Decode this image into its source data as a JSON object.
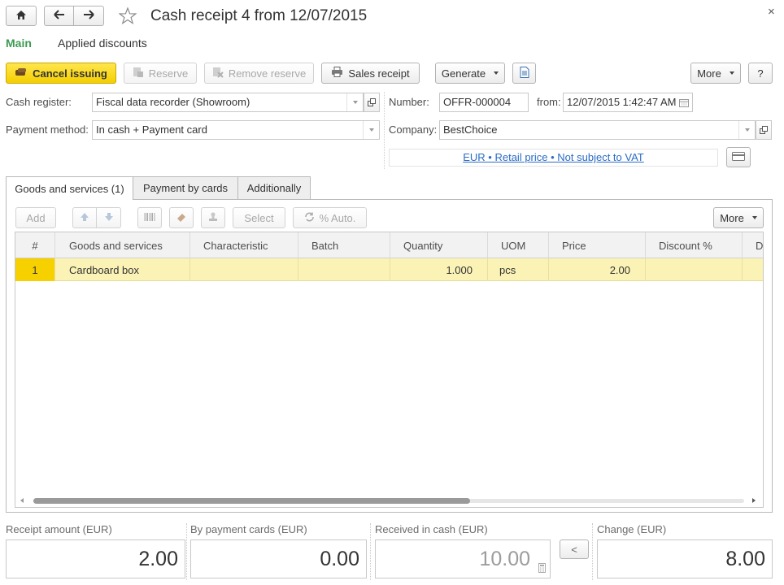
{
  "window": {
    "title": "Cash receipt 4 from 12/07/2015",
    "close_glyph": "×"
  },
  "nav": {
    "home_icon": "home-icon",
    "back_icon": "arrow-left-icon",
    "forward_icon": "arrow-right-icon",
    "star_icon": "star-icon"
  },
  "section_tabs": [
    {
      "label": "Main",
      "active": true
    },
    {
      "label": "Applied discounts",
      "active": false
    }
  ],
  "toolbar": {
    "cancel_issuing": "Cancel issuing",
    "reserve": "Reserve",
    "remove_reserve": "Remove reserve",
    "sales_receipt": "Sales receipt",
    "generate": "Generate",
    "more": "More",
    "help": "?"
  },
  "form": {
    "cash_register_label": "Cash register:",
    "cash_register_value": "Fiscal data recorder (Showroom)",
    "payment_method_label": "Payment method:",
    "payment_method_value": "In cash + Payment card",
    "number_label": "Number:",
    "number_value": "OFFR-000004",
    "from_label": "from:",
    "date_value": "12/07/2015  1:42:47 AM",
    "company_label": "Company:",
    "company_value": "BestChoice",
    "price_link": "EUR • Retail price • Not subject to VAT"
  },
  "doc_tabs": [
    {
      "label": "Goods and services (1)",
      "active": true
    },
    {
      "label": "Payment by cards",
      "active": false
    },
    {
      "label": "Additionally",
      "active": false
    }
  ],
  "table_toolbar": {
    "add": "Add",
    "select": "Select",
    "auto": "% Auto.",
    "more": "More"
  },
  "table": {
    "columns": [
      "#",
      "Goods and services",
      "Characteristic",
      "Batch",
      "Quantity",
      "UOM",
      "Price",
      "Discount %",
      "D"
    ],
    "rows": [
      {
        "num": "1",
        "goods": "Cardboard box",
        "characteristic": "",
        "batch": "",
        "quantity": "1.000",
        "uom": "pcs",
        "price": "2.00",
        "discount": ""
      }
    ]
  },
  "totals": {
    "receipt_amount_label": "Receipt amount (EUR)",
    "receipt_amount_value": "2.00",
    "by_cards_label": "By payment cards (EUR)",
    "by_cards_value": "0.00",
    "received_cash_label": "Received in cash (EUR)",
    "received_cash_value": "10.00",
    "transfer_button": "<",
    "change_label": "Change (EUR)",
    "change_value": "8.00"
  },
  "colors": {
    "accent_green": "#3d9a52",
    "primary_yellow": "#f5cf00",
    "selected_row": "#fbf2b6",
    "link_blue": "#2b6cc4"
  }
}
